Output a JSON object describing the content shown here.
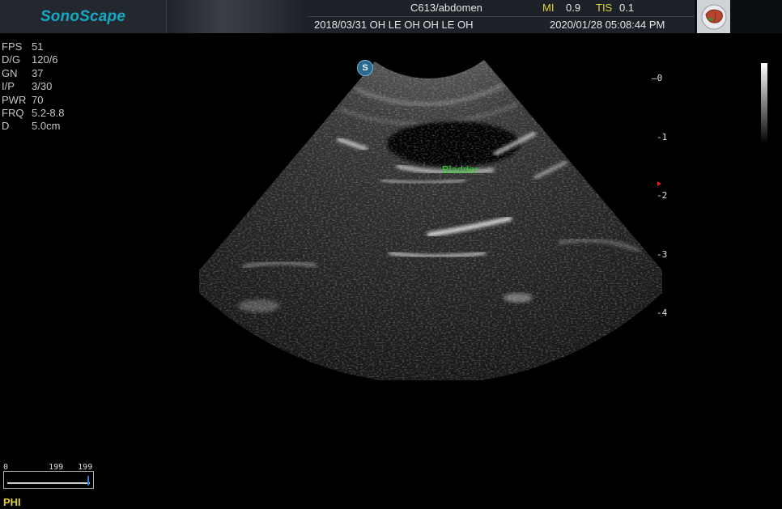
{
  "header": {
    "logo": "SonoScape",
    "probe_preset": "C613/abdomen",
    "mi_label": "MI",
    "mi_value": "0.9",
    "tis_label": "TIS",
    "tis_value": "0.1",
    "patient_info": "2018/03/31  OH LE OH OH LE OH",
    "datetime": "2020/01/28 05:08:44 PM",
    "organ_icon": "liver-organ-icon"
  },
  "params": [
    {
      "key": "FPS",
      "value": "51"
    },
    {
      "key": "D/G",
      "value": "120/6"
    },
    {
      "key": "GN",
      "value": "37"
    },
    {
      "key": "I/P",
      "value": "3/30"
    },
    {
      "key": "PWR",
      "value": "70"
    },
    {
      "key": "FRQ",
      "value": "5.2-8.8"
    },
    {
      "key": "D",
      "value": "5.0cm"
    }
  ],
  "image": {
    "annotation": "Bladder",
    "orientation_marker": "S"
  },
  "depth_scale": [
    "0",
    "1",
    "2",
    "3",
    "4"
  ],
  "cine": {
    "start": "0",
    "current": "199",
    "total": "199",
    "progress": 1.0
  },
  "mode_label": "PHI",
  "colors": {
    "logo": "#17a9c4",
    "annotation": "#28d428",
    "label_yellow": "#e2d23a"
  }
}
